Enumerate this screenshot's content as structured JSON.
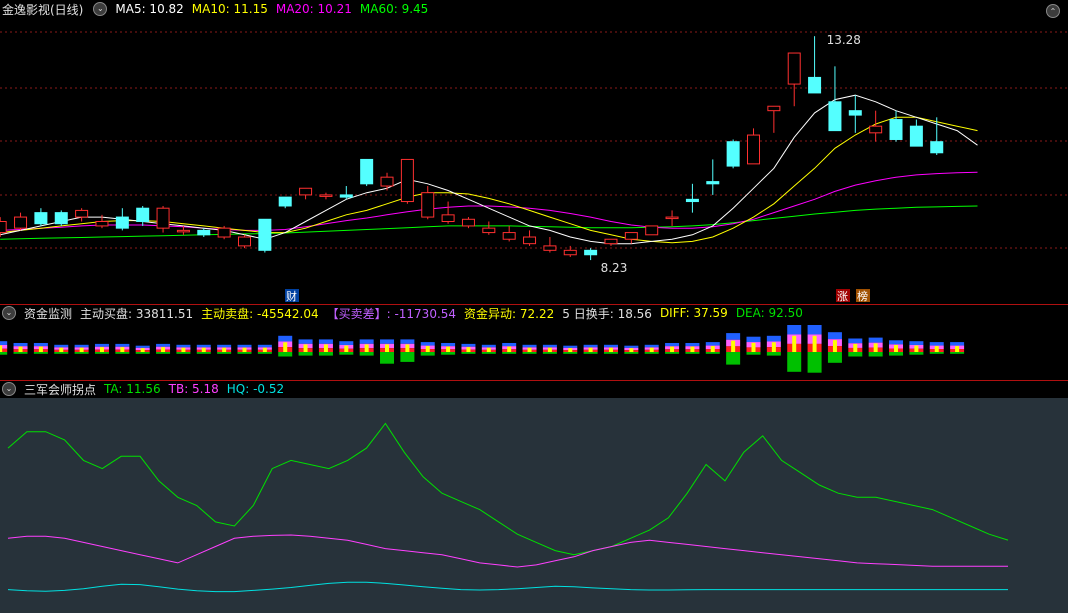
{
  "main": {
    "title": "金逸影视(日线)",
    "ma": [
      {
        "label": "MA5: 10.82",
        "color": "#ffffff"
      },
      {
        "label": "MA10: 11.15",
        "color": "#ffff00"
      },
      {
        "label": "MA20: 10.21",
        "color": "#ff00ff"
      },
      {
        "label": "MA60: 9.45",
        "color": "#00ff00"
      }
    ],
    "high_label": "13.28",
    "low_label": "8.23",
    "markers": {
      "cai": "财",
      "zhang": "涨",
      "bang": "榜"
    }
  },
  "fund": {
    "title": "资金监测",
    "items": [
      {
        "label": "主动买盘: 33811.51",
        "color": "#e0e0e0"
      },
      {
        "label": "主动卖盘: -45542.04",
        "color": "#ffff00"
      },
      {
        "label": "【买卖差】: -11730.54",
        "color": "#c060ff"
      },
      {
        "label": "资金异动: 72.22",
        "color": "#ffff00"
      },
      {
        "label": "5 日换手: 18.56",
        "color": "#e0e0e0"
      },
      {
        "label": "DIFF: 37.59",
        "color": "#ffff00"
      },
      {
        "label": "DEA: 92.50",
        "color": "#00e000"
      }
    ]
  },
  "sanjun": {
    "title": "三军会师拐点",
    "items": [
      {
        "label": "TA: 11.56",
        "color": "#00e000"
      },
      {
        "label": "TB: 5.18",
        "color": "#ff40ff"
      },
      {
        "label": "HQ: -0.52",
        "color": "#00e0e0"
      }
    ]
  },
  "chart_data": [
    {
      "type": "candlestick",
      "ylim": [
        7.6,
        13.6
      ],
      "x": [
        1,
        2,
        3,
        4,
        5,
        6,
        7,
        8,
        9,
        10,
        11,
        12,
        13,
        14,
        15,
        16,
        17,
        18,
        19,
        20,
        21,
        22,
        23,
        24,
        25,
        26,
        27,
        28,
        29,
        30,
        31,
        32,
        33,
        34,
        35,
        36,
        37,
        38,
        39,
        40,
        41,
        42,
        43,
        44,
        45,
        46,
        47,
        48,
        49,
        50
      ],
      "open": [
        8.85,
        8.95,
        9.3,
        9.3,
        9.2,
        9.0,
        9.2,
        9.4,
        8.95,
        8.9,
        8.9,
        8.75,
        8.55,
        9.15,
        9.65,
        9.7,
        9.7,
        9.7,
        10.5,
        9.9,
        9.55,
        9.2,
        9.1,
        9.0,
        8.85,
        8.7,
        8.6,
        8.45,
        8.35,
        8.45,
        8.6,
        8.7,
        8.8,
        9.2,
        9.6,
        10.0,
        10.9,
        10.4,
        11.6,
        12.2,
        12.35,
        11.8,
        11.6,
        11.1,
        11.4,
        11.25,
        10.9,
        10.55
      ],
      "close": [
        9.1,
        9.2,
        9.05,
        9.05,
        9.35,
        9.1,
        8.95,
        9.1,
        9.4,
        8.9,
        8.8,
        8.95,
        8.75,
        8.45,
        9.45,
        9.85,
        9.7,
        9.65,
        9.95,
        10.1,
        10.5,
        9.75,
        9.25,
        9.15,
        8.95,
        8.85,
        8.75,
        8.55,
        8.45,
        8.35,
        8.7,
        8.85,
        9.0,
        9.2,
        9.55,
        9.95,
        10.35,
        11.05,
        11.7,
        12.9,
        12.0,
        11.15,
        11.5,
        11.25,
        10.95,
        10.8,
        10.65
      ],
      "high": [
        9.2,
        9.3,
        9.4,
        9.35,
        9.4,
        9.25,
        9.4,
        9.45,
        9.45,
        9.0,
        8.95,
        9.0,
        8.8,
        9.15,
        9.65,
        9.85,
        9.75,
        9.9,
        10.5,
        10.2,
        10.5,
        9.9,
        9.55,
        9.2,
        9.1,
        9.0,
        8.9,
        8.75,
        8.55,
        8.5,
        8.65,
        8.85,
        8.95,
        9.35,
        9.95,
        10.5,
        10.95,
        11.2,
        11.7,
        12.9,
        13.28,
        12.6,
        11.95,
        11.6,
        11.6,
        11.4,
        11.45,
        11.0,
        10.6
      ],
      "low": [
        8.75,
        8.9,
        9.0,
        9.0,
        9.1,
        8.95,
        8.9,
        9.0,
        8.85,
        8.8,
        8.75,
        8.7,
        8.5,
        8.4,
        9.4,
        9.6,
        9.6,
        9.6,
        9.9,
        9.8,
        9.5,
        9.15,
        9.05,
        8.95,
        8.8,
        8.65,
        8.55,
        8.4,
        8.3,
        8.23,
        8.55,
        8.6,
        8.8,
        9.0,
        9.3,
        9.7,
        10.3,
        10.4,
        11.1,
        11.7,
        12.0,
        11.3,
        11.1,
        10.9,
        10.9,
        10.8,
        10.6,
        10.5
      ],
      "ma5": [
        8.8,
        8.9,
        9.0,
        9.1,
        9.2,
        9.2,
        9.15,
        9.1,
        9.05,
        9.0,
        8.95,
        8.9,
        8.8,
        8.7,
        8.85,
        9.1,
        9.35,
        9.6,
        9.75,
        9.85,
        10.05,
        9.95,
        9.8,
        9.6,
        9.4,
        9.2,
        9.0,
        8.9,
        8.75,
        8.65,
        8.6,
        8.6,
        8.65,
        8.7,
        8.8,
        9.0,
        9.4,
        9.85,
        10.3,
        11.0,
        11.55,
        11.85,
        11.95,
        11.8,
        11.6,
        11.45,
        11.3,
        11.15,
        10.82
      ],
      "ma10": [
        8.85,
        8.9,
        8.95,
        9.0,
        9.05,
        9.1,
        9.12,
        9.12,
        9.1,
        9.05,
        9.0,
        8.95,
        8.9,
        8.85,
        8.85,
        8.95,
        9.1,
        9.25,
        9.35,
        9.5,
        9.65,
        9.75,
        9.75,
        9.72,
        9.62,
        9.5,
        9.35,
        9.2,
        9.05,
        8.9,
        8.8,
        8.7,
        8.65,
        8.62,
        8.65,
        8.75,
        8.95,
        9.2,
        9.5,
        9.9,
        10.3,
        10.75,
        11.05,
        11.3,
        11.45,
        11.45,
        11.35,
        11.25,
        11.15
      ],
      "ma20": [
        8.9,
        8.92,
        8.95,
        8.97,
        9.0,
        9.02,
        9.02,
        9.02,
        9.0,
        8.98,
        8.95,
        8.92,
        8.9,
        8.9,
        8.92,
        8.98,
        9.05,
        9.12,
        9.18,
        9.25,
        9.32,
        9.38,
        9.42,
        9.45,
        9.45,
        9.43,
        9.4,
        9.35,
        9.28,
        9.2,
        9.1,
        9.02,
        8.97,
        8.95,
        8.95,
        8.98,
        9.05,
        9.15,
        9.3,
        9.45,
        9.6,
        9.78,
        9.92,
        10.02,
        10.1,
        10.15,
        10.18,
        10.2,
        10.21
      ],
      "ma60": [
        8.7,
        8.71,
        8.72,
        8.73,
        8.74,
        8.75,
        8.76,
        8.77,
        8.78,
        8.79,
        8.8,
        8.81,
        8.82,
        8.83,
        8.84,
        8.86,
        8.88,
        8.9,
        8.92,
        8.94,
        8.96,
        8.98,
        9.0,
        9.0,
        9.0,
        9.0,
        8.99,
        8.98,
        8.97,
        8.96,
        8.96,
        8.96,
        8.97,
        8.98,
        9.0,
        9.03,
        9.07,
        9.12,
        9.17,
        9.22,
        9.27,
        9.31,
        9.35,
        9.38,
        9.4,
        9.42,
        9.43,
        9.44,
        9.45
      ]
    },
    {
      "type": "bar",
      "values": [
        1.2,
        1.0,
        1.0,
        0.8,
        0.8,
        0.9,
        0.9,
        0.7,
        0.9,
        0.8,
        0.8,
        0.8,
        0.8,
        0.8,
        1.8,
        1.4,
        1.4,
        1.2,
        1.4,
        1.4,
        1.4,
        1.1,
        1.0,
        0.9,
        0.8,
        1.0,
        0.8,
        0.8,
        0.7,
        0.8,
        0.8,
        0.7,
        0.8,
        1.0,
        1.0,
        1.1,
        2.1,
        1.7,
        1.8,
        3.0,
        3.0,
        2.2,
        1.5,
        1.6,
        1.3,
        1.2,
        1.1,
        1.1
      ],
      "neg": [
        0.3,
        0.2,
        0.2,
        0.2,
        0.2,
        0.2,
        0.2,
        0.2,
        0.2,
        0.2,
        0.2,
        0.2,
        0.2,
        0.2,
        0.5,
        0.4,
        0.4,
        0.3,
        0.4,
        1.3,
        1.1,
        0.4,
        0.3,
        0.2,
        0.2,
        0.2,
        0.2,
        0.2,
        0.2,
        0.2,
        0.2,
        0.2,
        0.2,
        0.2,
        0.2,
        0.2,
        1.4,
        0.3,
        0.4,
        2.2,
        2.3,
        1.2,
        0.5,
        0.5,
        0.4,
        0.3,
        0.2,
        0.2
      ]
    },
    {
      "type": "line",
      "ylim": [
        -5,
        45
      ],
      "series": [
        {
          "name": "TA",
          "color": "#00e000",
          "values": [
            34,
            38,
            38,
            36,
            31,
            29,
            32,
            32,
            26,
            22,
            20,
            16,
            15,
            20,
            29,
            31,
            30,
            29,
            31,
            34,
            40,
            33,
            27,
            23,
            21,
            19,
            16,
            13,
            11,
            9,
            8,
            9,
            10,
            12,
            14,
            17,
            23,
            30,
            26,
            33,
            37,
            31,
            28,
            25,
            23,
            22,
            22,
            21,
            20,
            19,
            17,
            15,
            13,
            11.56
          ]
        },
        {
          "name": "TB",
          "color": "#ff40ff",
          "values": [
            12,
            12.5,
            12.5,
            12,
            11,
            10,
            9,
            8,
            7,
            6,
            8,
            10,
            12,
            12.5,
            12.7,
            12.8,
            12.5,
            12,
            11.5,
            10.5,
            9.5,
            9,
            8.5,
            8,
            7,
            6,
            5.5,
            5,
            5.5,
            6.5,
            7.5,
            9,
            10,
            11,
            11.5,
            11,
            10.5,
            10,
            9.5,
            9,
            8.5,
            8,
            7.5,
            7,
            6.5,
            6,
            5.8,
            5.6,
            5.4,
            5.2,
            5.18,
            5.18,
            5.18,
            5.18
          ]
        },
        {
          "name": "HQ",
          "color": "#00e0e0",
          "values": [
            -0.5,
            -0.8,
            -0.9,
            -0.7,
            -0.3,
            0.3,
            0.8,
            0.7,
            0.2,
            -0.4,
            -0.8,
            -1,
            -1,
            -0.7,
            -0.4,
            0,
            0.5,
            1,
            1.3,
            1.3,
            1,
            0.6,
            0.2,
            -0.2,
            -0.5,
            -0.6,
            -0.5,
            -0.3,
            0,
            0.3,
            0.2,
            -0.1,
            -0.3,
            -0.5,
            -0.6,
            -0.6,
            -0.55,
            -0.52,
            -0.52,
            -0.52,
            -0.52,
            -0.52,
            -0.52,
            -0.52,
            -0.52,
            -0.52,
            -0.52,
            -0.52,
            -0.52,
            -0.52,
            -0.52,
            -0.52,
            -0.52,
            -0.52
          ]
        }
      ]
    }
  ]
}
